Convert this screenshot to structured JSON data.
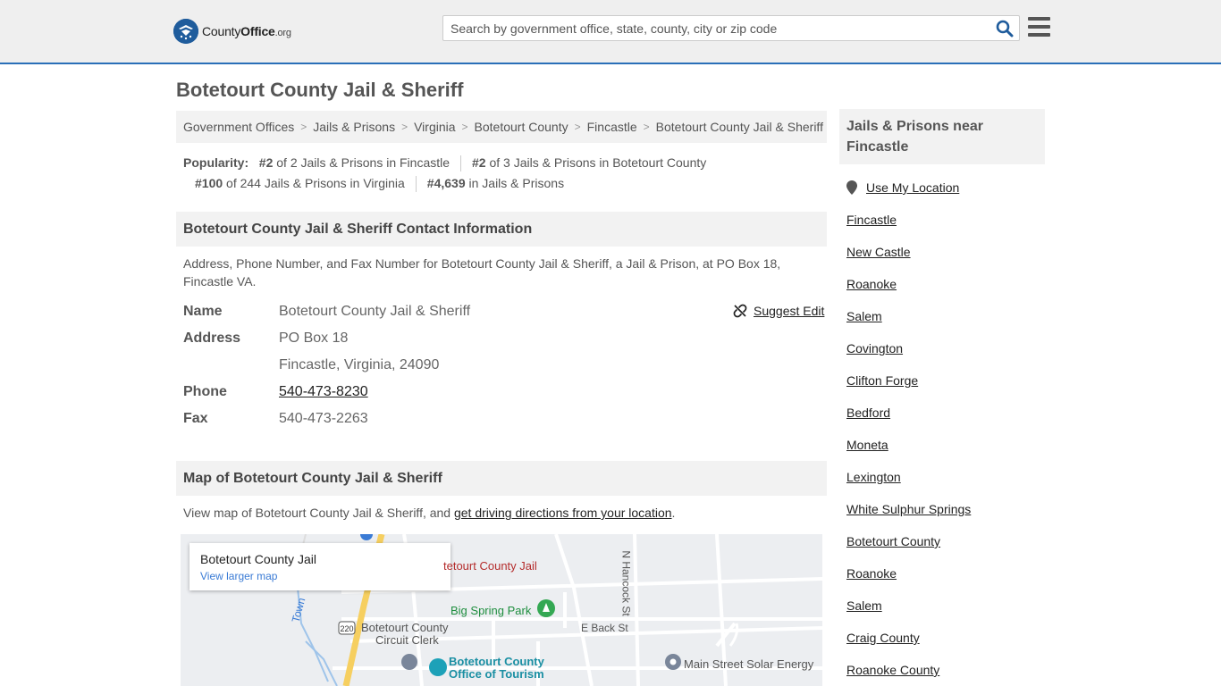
{
  "header": {
    "logo_main": "County",
    "logo_bold": "Office",
    "logo_suffix": ".org",
    "search_placeholder": "Search by government office, state, county, city or zip code"
  },
  "page": {
    "title": "Botetourt County Jail & Sheriff"
  },
  "breadcrumb": [
    "Government Offices",
    "Jails & Prisons",
    "Virginia",
    "Botetourt County",
    "Fincastle",
    "Botetourt County Jail & Sheriff"
  ],
  "popularity": {
    "label": "Popularity:",
    "items": [
      {
        "rank": "#2",
        "text": "of 2 Jails & Prisons in Fincastle"
      },
      {
        "rank": "#2",
        "text": "of 3 Jails & Prisons in Botetourt County"
      },
      {
        "rank": "#100",
        "text": "of 244 Jails & Prisons in Virginia"
      },
      {
        "rank": "#4,639",
        "text": "in Jails & Prisons"
      }
    ]
  },
  "contact": {
    "heading": "Botetourt County Jail & Sheriff Contact Information",
    "description": "Address, Phone Number, and Fax Number for Botetourt County Jail & Sheriff, a Jail & Prison, at PO Box 18, Fincastle VA.",
    "suggest_edit": "Suggest Edit",
    "name_label": "Name",
    "name": "Botetourt County Jail & Sheriff",
    "address_label": "Address",
    "address_line1": "PO Box 18",
    "address_line2": "Fincastle, Virginia, 24090",
    "phone_label": "Phone",
    "phone": "540-473-8230",
    "fax_label": "Fax",
    "fax": "540-473-2263"
  },
  "map_section": {
    "heading": "Map of Botetourt County Jail & Sheriff",
    "desc_prefix": "View map of Botetourt County Jail & Sheriff, and ",
    "desc_link": "get driving directions from your location",
    "desc_suffix": ".",
    "card_title": "Botetourt County Jail",
    "card_link": "View larger map",
    "labels": {
      "jail": "tetourt County Jail",
      "park": "Big Spring Park",
      "clerk1": "Botetourt County",
      "clerk2": "Circuit Clerk",
      "tourism1": "Botetourt County",
      "tourism2": "Office of Tourism",
      "solar": "Main Street Solar Energy",
      "back_st": "E Back St",
      "hancock": "N Hancock St",
      "town": "Town",
      "route": "220"
    }
  },
  "sidebar": {
    "heading": "Jails & Prisons near Fincastle",
    "use_location": "Use My Location",
    "links": [
      "Fincastle",
      "New Castle",
      "Roanoke",
      "Salem",
      "Covington",
      "Clifton Forge",
      "Bedford",
      "Moneta",
      "Lexington",
      "White Sulphur Springs",
      "Botetourt County",
      "Roanoke",
      "Salem",
      "Craig County",
      "Roanoke County"
    ]
  }
}
